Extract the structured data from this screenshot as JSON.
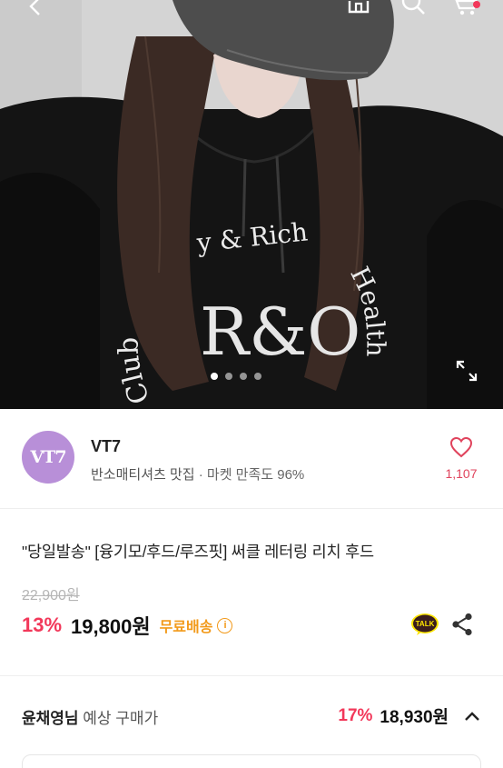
{
  "topbar": {
    "icons": [
      "back-icon",
      "home-icon",
      "search-icon",
      "cart-icon"
    ]
  },
  "hero": {
    "print_text": {
      "arc_left": "Club",
      "arc_top": "y & Rich",
      "arc_right": "Health",
      "logo": "R&O"
    },
    "carousel": {
      "count": 4,
      "active": 1
    }
  },
  "shop": {
    "avatar_text": "VT7",
    "name": "VT7",
    "tagline": "반소매티셔츠 맛집",
    "satisfaction": " · 마켓 만족도 96%",
    "likes": "1,107"
  },
  "product": {
    "title": "\"당일발송\" [융기모/후드/루즈핏] 써클 레터링 리치 후드",
    "original_price": "22,900원",
    "discount": "13%",
    "price": "19,800원",
    "shipping": "무료배송",
    "talk_label": "TALK"
  },
  "expected": {
    "user": "윤채영님",
    "label": " 예상 구매가",
    "discount": "17%",
    "price": "18,930원"
  },
  "colors": {
    "accent_pink": "#f2385a",
    "shipping_orange": "#f29a1b",
    "avatar_purple": "#b88fd8",
    "kakao_yellow": "#fee500"
  }
}
